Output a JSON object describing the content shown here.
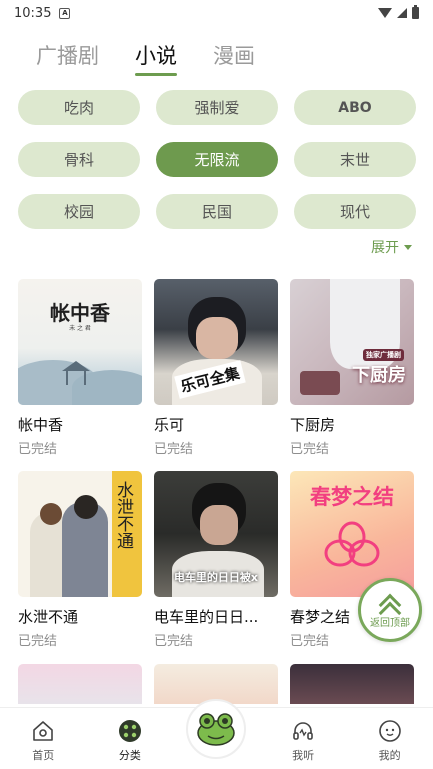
{
  "status_bar": {
    "time": "10:35",
    "notification_icon": "A"
  },
  "top_tabs": [
    {
      "label": "广播剧",
      "active": false
    },
    {
      "label": "小说",
      "active": true
    },
    {
      "label": "漫画",
      "active": false
    }
  ],
  "tags": [
    {
      "label": "吃肉",
      "active": false
    },
    {
      "label": "强制爱",
      "active": false
    },
    {
      "label": "ABO",
      "active": false
    },
    {
      "label": "骨科",
      "active": false
    },
    {
      "label": "无限流",
      "active": true
    },
    {
      "label": "末世",
      "active": false
    },
    {
      "label": "校园",
      "active": false
    },
    {
      "label": "民国",
      "active": false
    },
    {
      "label": "现代",
      "active": false
    }
  ],
  "expand_label": "展开",
  "books": [
    {
      "title": "帐中香",
      "status": "已完结",
      "cover_text": "帐中香",
      "cover_sub": "未 之 君"
    },
    {
      "title": "乐可",
      "status": "已完结",
      "cover_text": "乐可全集"
    },
    {
      "title": "下厨房",
      "status": "已完结",
      "cover_text": "下厨房",
      "cover_label": "独家广播剧"
    },
    {
      "title": "水泄不通",
      "status": "已完结",
      "cover_text": "水泄不通"
    },
    {
      "title": "电车里的日日...",
      "status": "已完结",
      "cover_text": "电车里的日日被x"
    },
    {
      "title": "春梦之结",
      "status": "已完结",
      "cover_text": "春梦之结"
    }
  ],
  "back_to_top_label": "返回顶部",
  "bottom_nav": [
    {
      "label": "首页",
      "icon": "home-icon",
      "active": false
    },
    {
      "label": "分类",
      "icon": "category-icon",
      "active": true
    },
    {
      "label": "",
      "icon": "frog-icon",
      "active": false
    },
    {
      "label": "我听",
      "icon": "headphones-icon",
      "active": false
    },
    {
      "label": "我的",
      "icon": "profile-icon",
      "active": false
    }
  ],
  "colors": {
    "accent": "#6d9c4f",
    "tag_bg": "#dde8cf",
    "tag_active": "#6e9a4e"
  }
}
